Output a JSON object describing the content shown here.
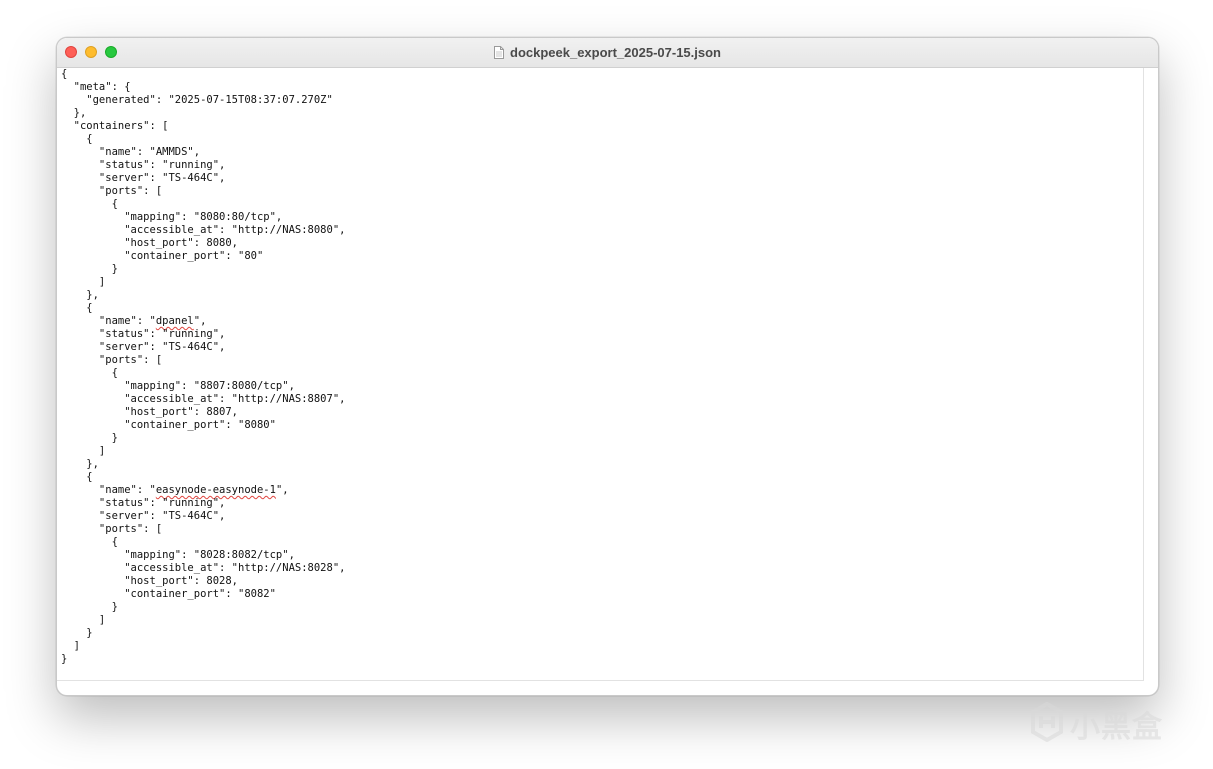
{
  "window": {
    "title": "dockpeek_export_2025-07-15.json"
  },
  "icons": {
    "close": "close-button",
    "minimize": "minimize-button",
    "zoom": "zoom-button",
    "document": "document-icon",
    "watermark": "xiaoheihe-logo-icon"
  },
  "colors": {
    "close": "#fe5f57",
    "minimize": "#febc2e",
    "zoom": "#28c840"
  },
  "editor": {
    "lines": [
      "{",
      "  \"meta\": {",
      "    \"generated\": \"2025-07-15T08:37:07.270Z\"",
      "  },",
      "  \"containers\": [",
      "    {",
      "      \"name\": \"AMMDS\",",
      "      \"status\": \"running\",",
      "      \"server\": \"TS-464C\",",
      "      \"ports\": [",
      "        {",
      "          \"mapping\": \"8080:80/tcp\",",
      "          \"accessible_at\": \"http://NAS:8080\",",
      "          \"host_port\": 8080,",
      "          \"container_port\": \"80\"",
      "        }",
      "      ]",
      "    },",
      "    {",
      "      \"name\": \"dpanel\",",
      "      \"status\": \"running\",",
      "      \"server\": \"TS-464C\",",
      "      \"ports\": [",
      "        {",
      "          \"mapping\": \"8807:8080/tcp\",",
      "          \"accessible_at\": \"http://NAS:8807\",",
      "          \"host_port\": 8807,",
      "          \"container_port\": \"8080\"",
      "        }",
      "      ]",
      "    },",
      "    {",
      "      \"name\": \"easynode-easynode-1\",",
      "      \"status\": \"running\",",
      "      \"server\": \"TS-464C\",",
      "      \"ports\": [",
      "        {",
      "          \"mapping\": \"8028:8082/tcp\",",
      "          \"accessible_at\": \"http://NAS:8028\",",
      "          \"host_port\": 8028,",
      "          \"container_port\": \"8082\"",
      "        }",
      "      ]",
      "    }",
      "  ]",
      "}"
    ],
    "spellcheck_words": [
      "dpanel",
      "easynode-easynode-1"
    ]
  },
  "watermark": {
    "text": "小黑盒"
  }
}
